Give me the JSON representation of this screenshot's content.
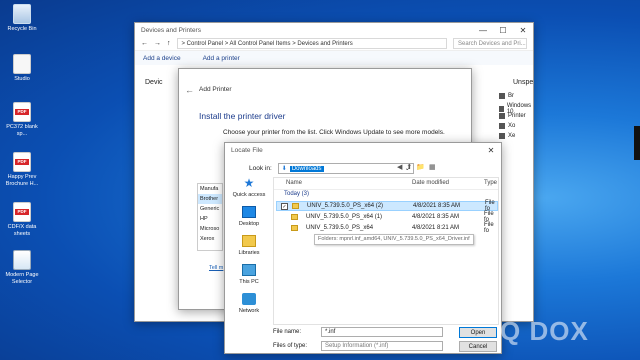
{
  "desktop": {
    "icons": [
      {
        "label": "Recycle Bin",
        "kind": "bin"
      },
      {
        "label": "Studio",
        "kind": "file"
      },
      {
        "label": "PC372 blank sp...",
        "kind": "pdf"
      },
      {
        "label": "Happy Prev Brochure H...",
        "kind": "pdf"
      },
      {
        "label": "CDF/X data sheets",
        "kind": "pdf"
      },
      {
        "label": "Modern Page Selector",
        "kind": "exe"
      }
    ]
  },
  "devices_window": {
    "title": "Devices and Printers",
    "breadcrumb": "> Control Panel > All Control Panel Items > Devices and Printers",
    "search_placeholder": "Search Devices and Pri...",
    "toolbar": [
      "Add a device",
      "Add a printer"
    ],
    "section_left": "Devic",
    "section_right": "Unspe",
    "right_items": [
      "Br",
      "Windows 10",
      "Printer",
      "Xo",
      "Xe"
    ],
    "controls": [
      "—",
      "☐",
      "✕"
    ]
  },
  "add_printer": {
    "title": "Add Printer",
    "heading": "Install the printer driver",
    "description": "Choose your printer from the list. Click Windows Update to see more models.",
    "manufacturers": [
      "Manufa",
      "Brother",
      "Generic",
      "HP",
      "Microso",
      "Xerox"
    ],
    "selected_manufacturer": "Brother",
    "link": "Tell m"
  },
  "locate_file": {
    "title": "Locate File",
    "look_in_label": "Look in:",
    "look_in_value": "Downloads",
    "places": [
      "Quick access",
      "Desktop",
      "Libraries",
      "This PC",
      "Network"
    ],
    "columns": {
      "name": "Name",
      "date": "Date modified",
      "type": "Type"
    },
    "group": "Today (3)",
    "files": [
      {
        "name": "UNIV_5.739.5.0_PS_x64 (2)",
        "date": "4/8/2021 8:35 AM",
        "type": "File fo",
        "selected": true
      },
      {
        "name": "UNIV_5.739.5.0_PS_x64 (1)",
        "date": "4/8/2021 8:35 AM",
        "type": "File fo",
        "selected": false
      },
      {
        "name": "UNIV_5.739.5.0_PS_x64",
        "date": "4/8/2021 8:21 AM",
        "type": "File fo",
        "selected": false
      }
    ],
    "tooltip": "Folders: mpnrl.inf_amd64, UNIV_5.739.5.0_PS_x64_Driver.inf",
    "file_name_label": "File name:",
    "file_name_value": "*.inf",
    "files_of_type_label": "Files of type:",
    "files_of_type_value": "Setup Information (*.inf)",
    "open_button": "Open",
    "cancel_button": "Cancel",
    "controls": [
      "✕"
    ]
  },
  "watermark": "Q DOX"
}
